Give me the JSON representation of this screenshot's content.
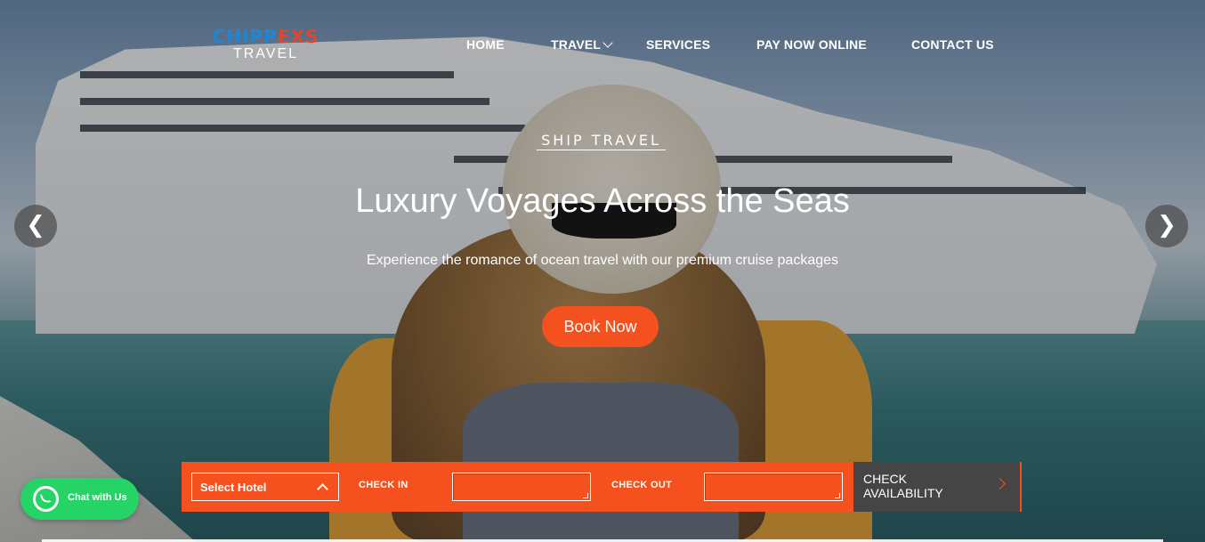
{
  "logo": {
    "brand_a": "CHIPP",
    "brand_b": "EXS",
    "sub": "TRAVEL"
  },
  "nav": {
    "items": [
      {
        "label": "HOME"
      },
      {
        "label": "TRAVEL",
        "has_dropdown": true
      },
      {
        "label": "SERVICES"
      },
      {
        "label": "PAY NOW ONLINE"
      },
      {
        "label": "CONTACT US"
      }
    ]
  },
  "hero": {
    "kicker": "SHIP TRAVEL",
    "headline": "Luxury Voyages Across the Seas",
    "tagline": "Experience the romance of ocean travel with our premium cruise packages",
    "cta_label": "Book Now",
    "prev_glyph": "❮",
    "next_glyph": "❯"
  },
  "booking": {
    "select_hotel": "Select Hotel",
    "check_in_label": "CHECK IN",
    "check_in_value": "",
    "check_out_label": "CHECK OUT",
    "check_out_value": "",
    "check_availability": "CHECK AVAILABILITY"
  },
  "chat": {
    "label": "Chat with Us"
  },
  "colors": {
    "accent": "#f4511e",
    "logo_blue": "#1f86d6",
    "logo_red": "#e2452f",
    "whatsapp": "#25d366",
    "dark_button": "#454545"
  },
  "icons": {
    "prev": "chevron-left-icon",
    "next": "chevron-right-icon",
    "dropdown": "chevron-down-icon",
    "select_caret": "chevron-up-icon",
    "availability_arrow": "chevron-right-icon",
    "chat": "whatsapp-icon"
  }
}
